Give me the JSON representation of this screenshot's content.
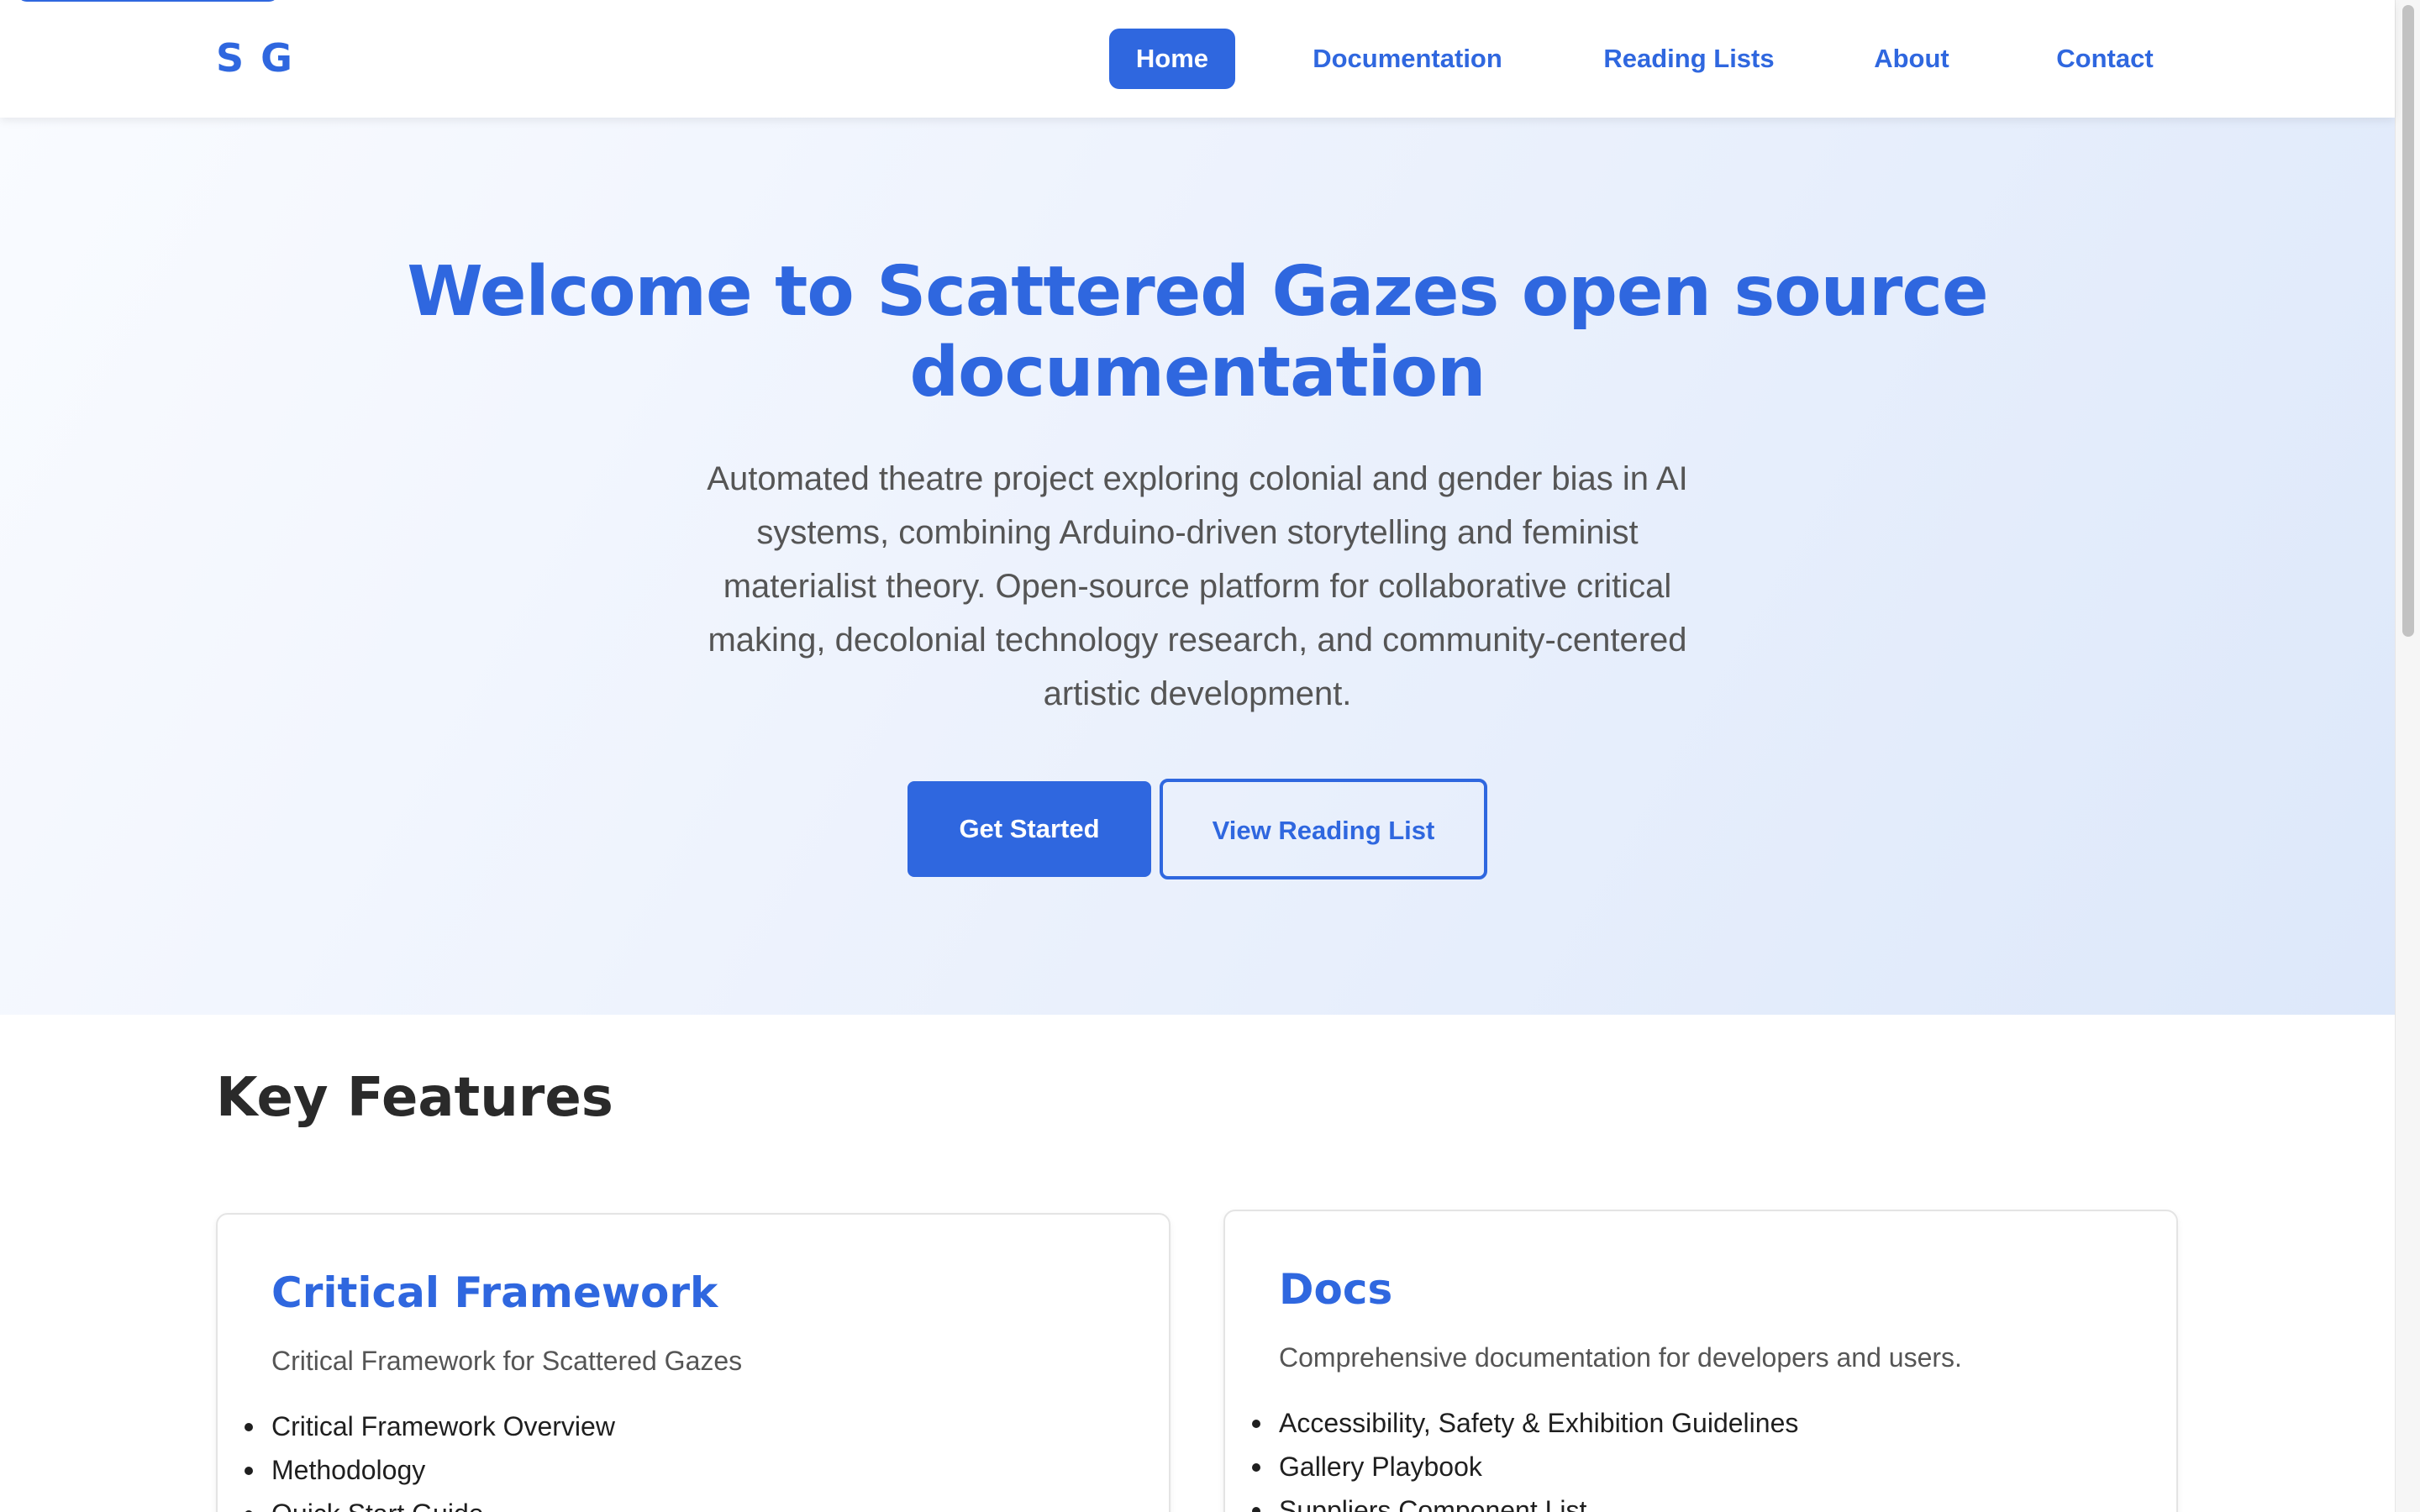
{
  "brand": {
    "logo_text": "S G"
  },
  "nav": {
    "items": [
      {
        "label": "Home",
        "active": true
      },
      {
        "label": "Documentation",
        "active": false
      },
      {
        "label": "Reading Lists",
        "active": false
      },
      {
        "label": "About",
        "active": false
      },
      {
        "label": "Contact",
        "active": false
      }
    ]
  },
  "hero": {
    "title": "Welcome to Scattered Gazes open source documentation",
    "description": "Automated theatre project exploring colonial and gender bias in AI systems, combining Arduino-driven storytelling and feminist materialist theory. Open-source platform for collaborative critical making, decolonial technology research, and community-centered artistic development.",
    "primary_button": "Get Started",
    "secondary_button": "View Reading List"
  },
  "features": {
    "heading": "Key Features",
    "cards": [
      {
        "title": "Critical Framework",
        "description": "Critical Framework for Scattered Gazes",
        "items": [
          "Critical Framework Overview",
          "Methodology",
          "Quick Start Guide"
        ]
      },
      {
        "title": "Docs",
        "description": "Comprehensive documentation for developers and users.",
        "items": [
          "Accessibility, Safety & Exhibition Guidelines",
          "Gallery Playbook",
          "Suppliers Component List"
        ]
      }
    ]
  },
  "colors": {
    "accent": "#2f67df",
    "heading_dark": "#2a2a2a",
    "muted_text": "#555555"
  }
}
